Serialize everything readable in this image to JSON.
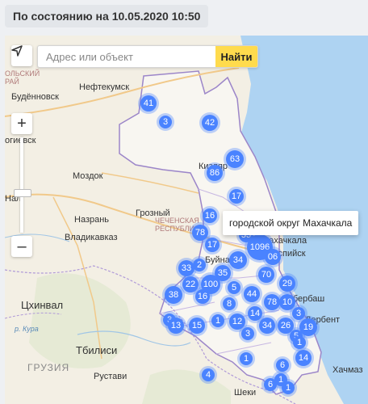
{
  "status": {
    "text": "По состоянию на 10.05.2020 10:50"
  },
  "search": {
    "placeholder": "Адрес или объект",
    "button_label": "Найти"
  },
  "controls": {
    "locate_icon": "locate-arrow-icon",
    "zoom_in_label": "+",
    "zoom_out_label": "–"
  },
  "tooltip": {
    "text": "городской округ Махачкала"
  },
  "places": {
    "budennovsk": "Будённовск",
    "neftekumsk": "Нефтекумск",
    "mozdok": "Моздок",
    "nazran": "Назрань",
    "vladikavkaz": "Владикавказ",
    "grozny": "Грозный",
    "tskhinval": "Цхинвал",
    "tbilisi": "Тбилиси",
    "rustavi": "Рустави",
    "sheki": "Шеки",
    "khachmaz": "Хачмаз",
    "kaspiysk": "Каспийск",
    "buynaksk": "Буйнакск",
    "derbent": "Дербент",
    "izberbash": "Избербаш",
    "kizlyar": "Кизляр",
    "makhachkala": "Махачкала",
    "chechnya_1": "ЧЕЧЕНСКАЯ",
    "chechnya_2": "РЕСПУБЛИКА",
    "georgia": "ГРУЗИЯ",
    "kura": "р. Кура",
    "edge_1": "ОЛЬСКИЙ",
    "edge_2": "РАЙ",
    "edge_3": "огиевск",
    "edge_4": "Нал"
  },
  "clusters": [
    "41",
    "3",
    "42",
    "63",
    "86",
    "17",
    "16",
    "78",
    "17",
    "55",
    "1096",
    "06",
    "34",
    "33",
    "2",
    "35",
    "70",
    "22",
    "100",
    "29",
    "38",
    "16",
    "5",
    "44",
    "78",
    "10",
    "3",
    "8",
    "14",
    "3",
    "13",
    "15",
    "1",
    "12",
    "34",
    "26",
    "5",
    "19",
    "3",
    "1",
    "14",
    "1",
    "6",
    "1",
    "4",
    "6",
    "1"
  ],
  "colors": {
    "cluster": "#4a83ff",
    "sea": "#aed3f2",
    "land": "#f3efe4",
    "region_fill": "#f8f6f1",
    "border": "#9c86c9",
    "button": "#ffdb4d"
  }
}
